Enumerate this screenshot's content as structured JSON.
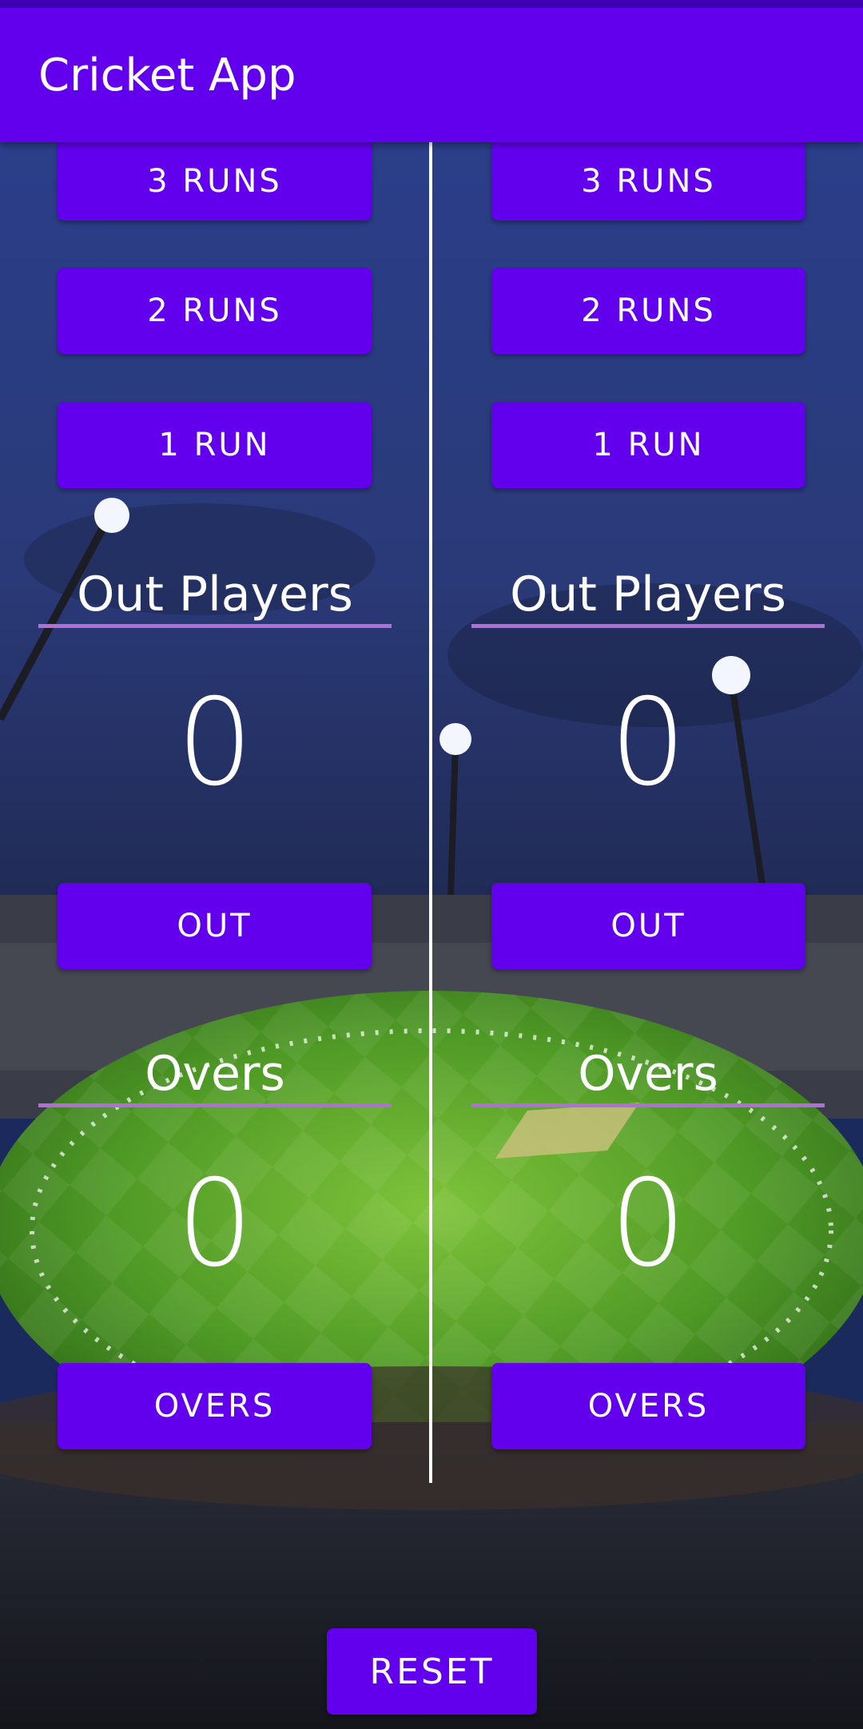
{
  "app": {
    "title": "Cricket App"
  },
  "teams": [
    {
      "buttons": {
        "three_runs": "3 RUNS",
        "two_runs": "2 RUNS",
        "one_run": "1 RUN",
        "out": "OUT",
        "overs": "OVERS"
      },
      "out_players": {
        "label": "Out Players",
        "value": "0"
      },
      "overs": {
        "label": "Overs",
        "value": "0"
      }
    },
    {
      "buttons": {
        "three_runs": "3 RUNS",
        "two_runs": "2 RUNS",
        "one_run": "1 RUN",
        "out": "OUT",
        "overs": "OVERS"
      },
      "out_players": {
        "label": "Out Players",
        "value": "0"
      },
      "overs": {
        "label": "Overs",
        "value": "0"
      }
    }
  ],
  "reset_label": "RESET",
  "colors": {
    "primary": "#6200ee",
    "status_bar": "#3f00b5",
    "underline": "#b06fd6"
  }
}
